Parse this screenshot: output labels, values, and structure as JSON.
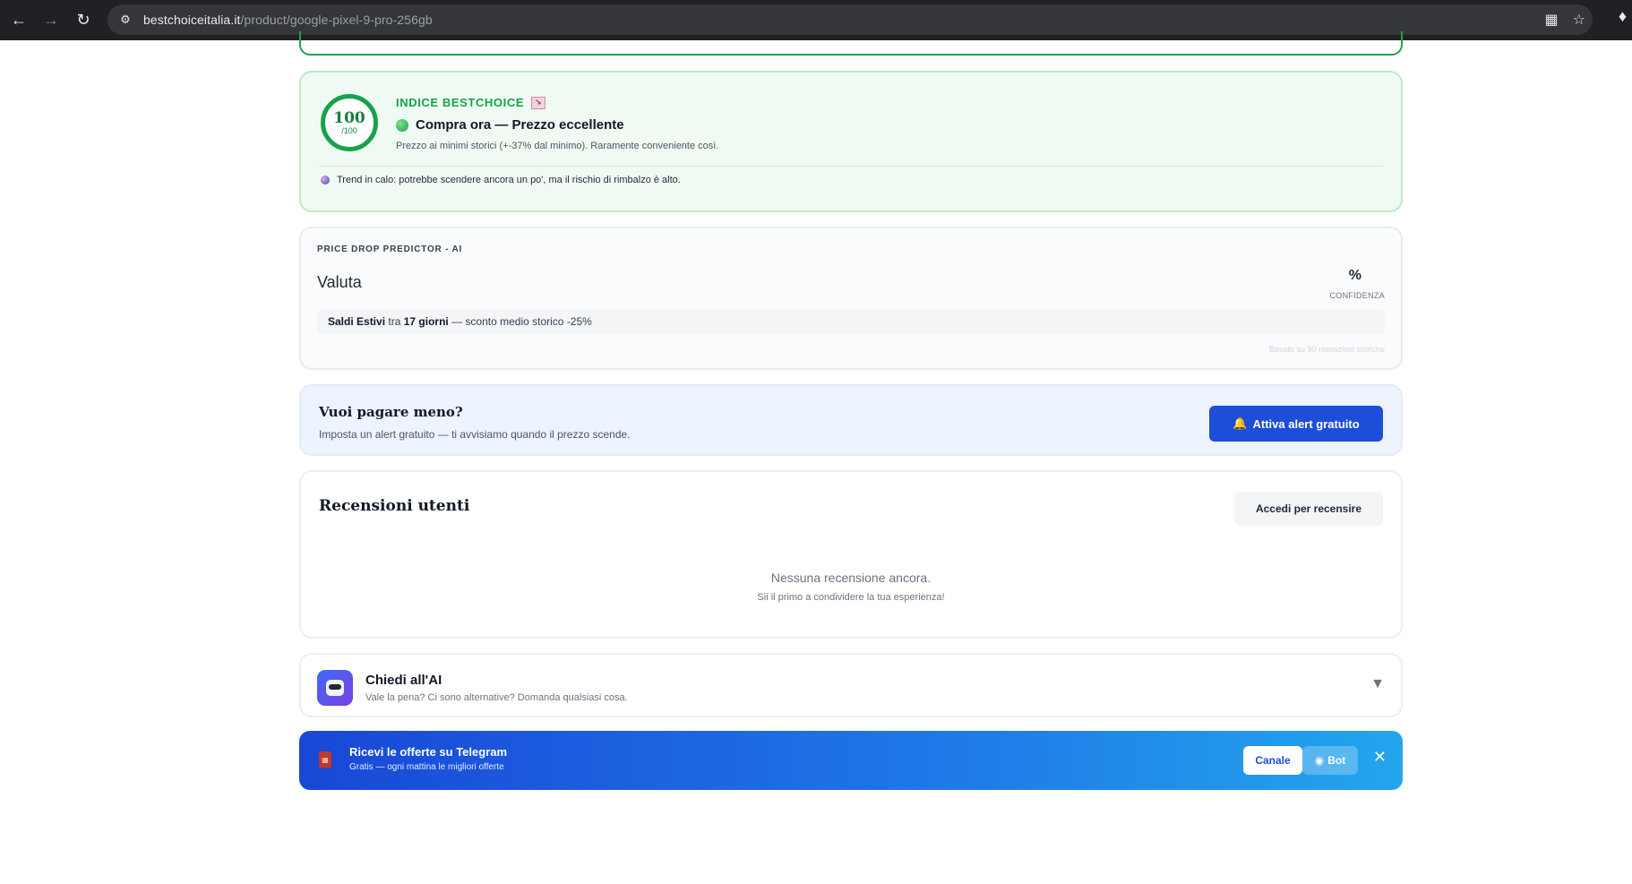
{
  "browser": {
    "url_domain": "bestchoiceitalia.it",
    "url_path": "/product/google-pixel-9-pro-256gb"
  },
  "index_card": {
    "score": "100",
    "score_max": "/100",
    "kicker": "INDICE BESTCHOICE",
    "verdict": "Compra ora — Prezzo eccellente",
    "description": "Prezzo ai minimi storici (+-37% dal minimo). Raramente conveniente così.",
    "trend": "Trend in calo: potrebbe scendere ancora un po', ma il rischio di rimbalzo è alto."
  },
  "predictor_card": {
    "kicker": "PRICE DROP PREDICTOR - AI",
    "title": "Valuta",
    "confidence_value": "%",
    "confidence_label": "CONFIDENZA",
    "event_name": "Saldi Estivi",
    "event_between": "tra",
    "event_days": "17 giorni",
    "event_rest": "— sconto medio storico -25%",
    "footnote": "Basato su 90 rilevazioni storiche"
  },
  "alert_card": {
    "title": "Vuoi pagare meno?",
    "subtitle": "Imposta un alert gratuito — ti avvisiamo quando il prezzo scende.",
    "button_label": "Attiva alert gratuito"
  },
  "reviews_card": {
    "title": "Recensioni utenti",
    "login_button": "Accedi per recensire",
    "empty_title": "Nessuna recensione ancora.",
    "empty_subtitle": "Sii il primo a condividere la tua esperienza!"
  },
  "ai_card": {
    "title": "Chiedi all'AI",
    "subtitle": "Vale la pena? Ci sono alternative? Domanda qualsiasi cosa."
  },
  "telegram_banner": {
    "title": "Ricevi le offerte su Telegram",
    "subtitle": "Gratis — ogni mattina le migliori offerte",
    "channel_button": "Canale",
    "bot_button": "Bot"
  },
  "colors": {
    "accent_green": "#16a34a",
    "primary_blue": "#1d4ed8"
  }
}
